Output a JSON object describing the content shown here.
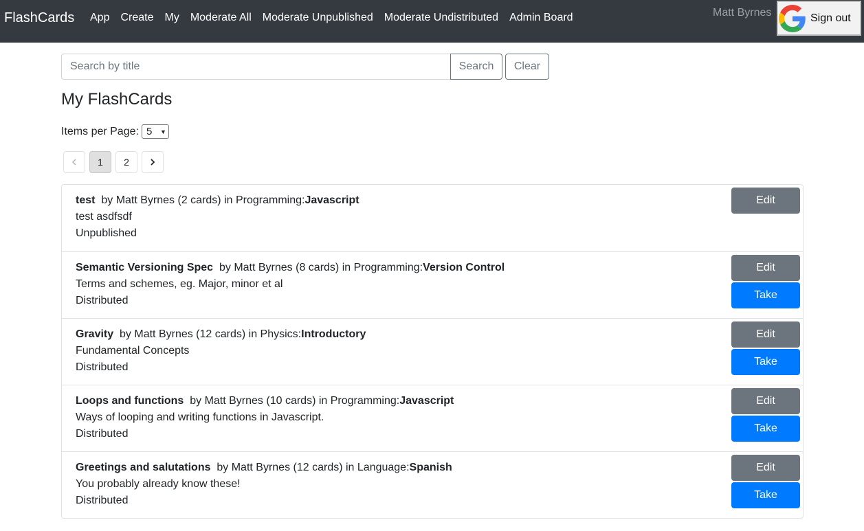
{
  "nav": {
    "brand": "FlashCards",
    "links": [
      "App",
      "Create",
      "My",
      "Moderate All",
      "Moderate Unpublished",
      "Moderate Undistributed",
      "Admin Board"
    ],
    "user_name": "Matt Byrnes",
    "sign_out_label": "Sign out"
  },
  "search": {
    "placeholder": "Search by title",
    "value": "",
    "search_label": "Search",
    "clear_label": "Clear"
  },
  "page_title": "My FlashCards",
  "items_per_page": {
    "label": "Items per Page:",
    "selected": "5"
  },
  "pagination": {
    "pages": [
      "1",
      "2"
    ],
    "current": "1",
    "prev_icon": "chevron-left-icon",
    "next_icon": "chevron-right-icon"
  },
  "items": [
    {
      "title": "test",
      "meta": "by Matt Byrnes (2 cards) in Programming:",
      "category": "Javascript",
      "description": "test asdfsdf",
      "status": "Unpublished",
      "edit_label": "Edit"
    },
    {
      "title": "Semantic Versioning Spec",
      "meta": "by Matt Byrnes (8 cards) in Programming:",
      "category": "Version Control",
      "description": "Terms and schemes, eg. Major, minor et al",
      "status": "Distributed",
      "edit_label": "Edit",
      "take_label": "Take"
    },
    {
      "title": "Gravity",
      "meta": "by Matt Byrnes (12 cards) in Physics:",
      "category": "Introductory",
      "description": "Fundamental Concepts",
      "status": "Distributed",
      "edit_label": "Edit",
      "take_label": "Take"
    },
    {
      "title": "Loops and functions",
      "meta": "by Matt Byrnes (10 cards) in Programming:",
      "category": "Javascript",
      "description": "Ways of looping and writing functions in Javascript.",
      "status": "Distributed",
      "edit_label": "Edit",
      "take_label": "Take"
    },
    {
      "title": "Greetings and salutations",
      "meta": "by Matt Byrnes (12 cards) in Language:",
      "category": "Spanish",
      "description": "You probably already know these!",
      "status": "Distributed",
      "edit_label": "Edit",
      "take_label": "Take"
    }
  ],
  "colors": {
    "navbar": "#343a40",
    "edit_button": "#6c757d",
    "take_button": "#007bff"
  }
}
